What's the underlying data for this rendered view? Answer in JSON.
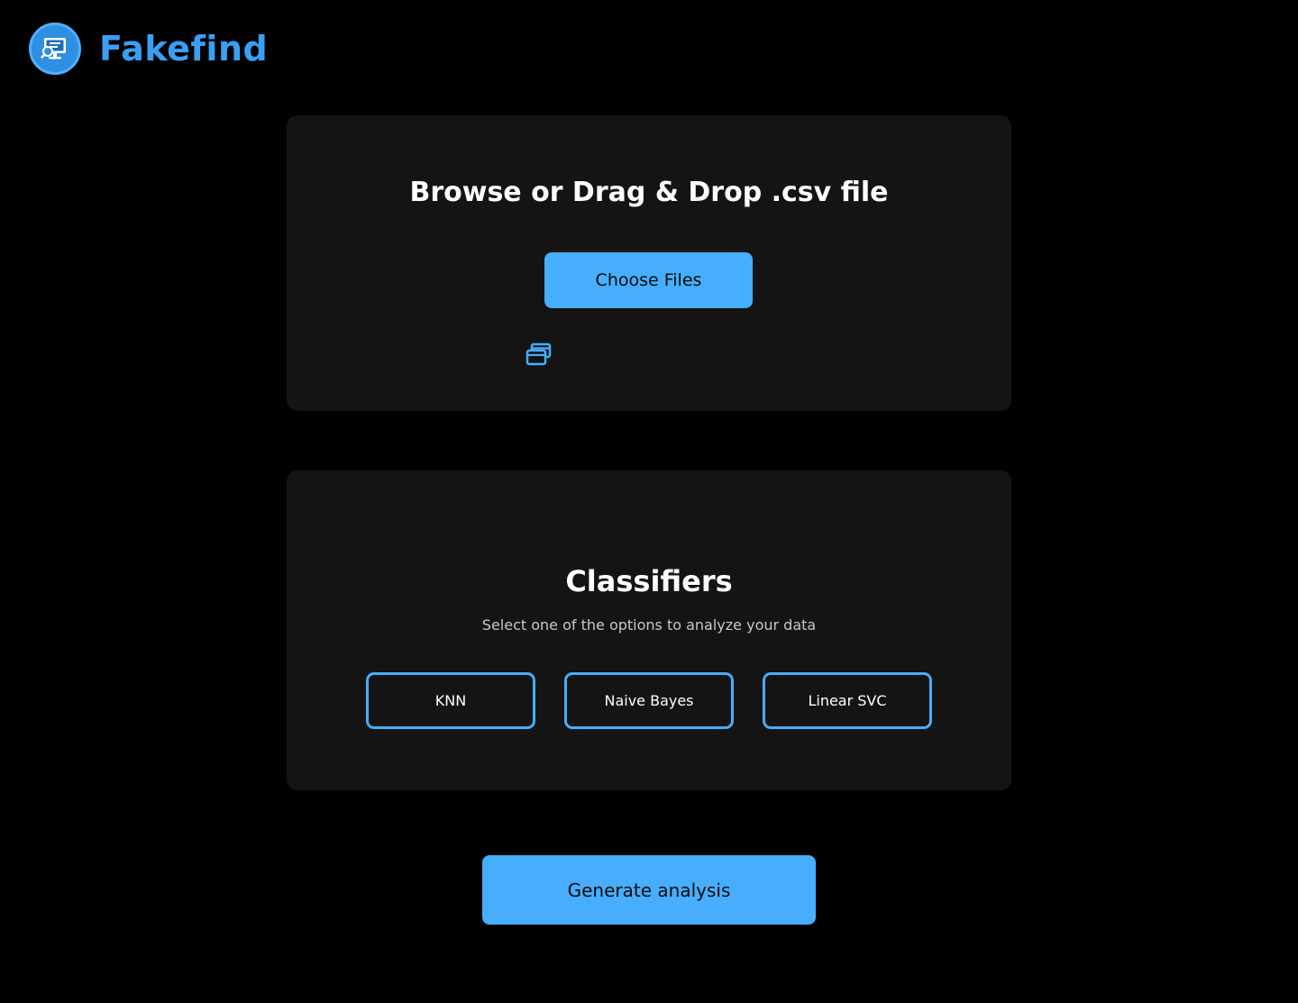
{
  "app": {
    "name": "Fakefind",
    "logo_icon": "monitor-search-icon",
    "accent_color": "#46aefc",
    "logo_text_color": "#3a9ff2",
    "background_color": "#000000",
    "card_color": "#141414"
  },
  "upload": {
    "title": "Browse or Drag & Drop .csv file",
    "choose_button_label": "Choose Files",
    "file_icon": "windows-stack-icon"
  },
  "classifiers": {
    "title": "Classifiers",
    "subtitle": "Select one of the options to analyze your data",
    "options": [
      {
        "label": "KNN"
      },
      {
        "label": "Naive Bayes"
      },
      {
        "label": "Linear SVC"
      }
    ]
  },
  "actions": {
    "generate_label": "Generate analysis"
  }
}
